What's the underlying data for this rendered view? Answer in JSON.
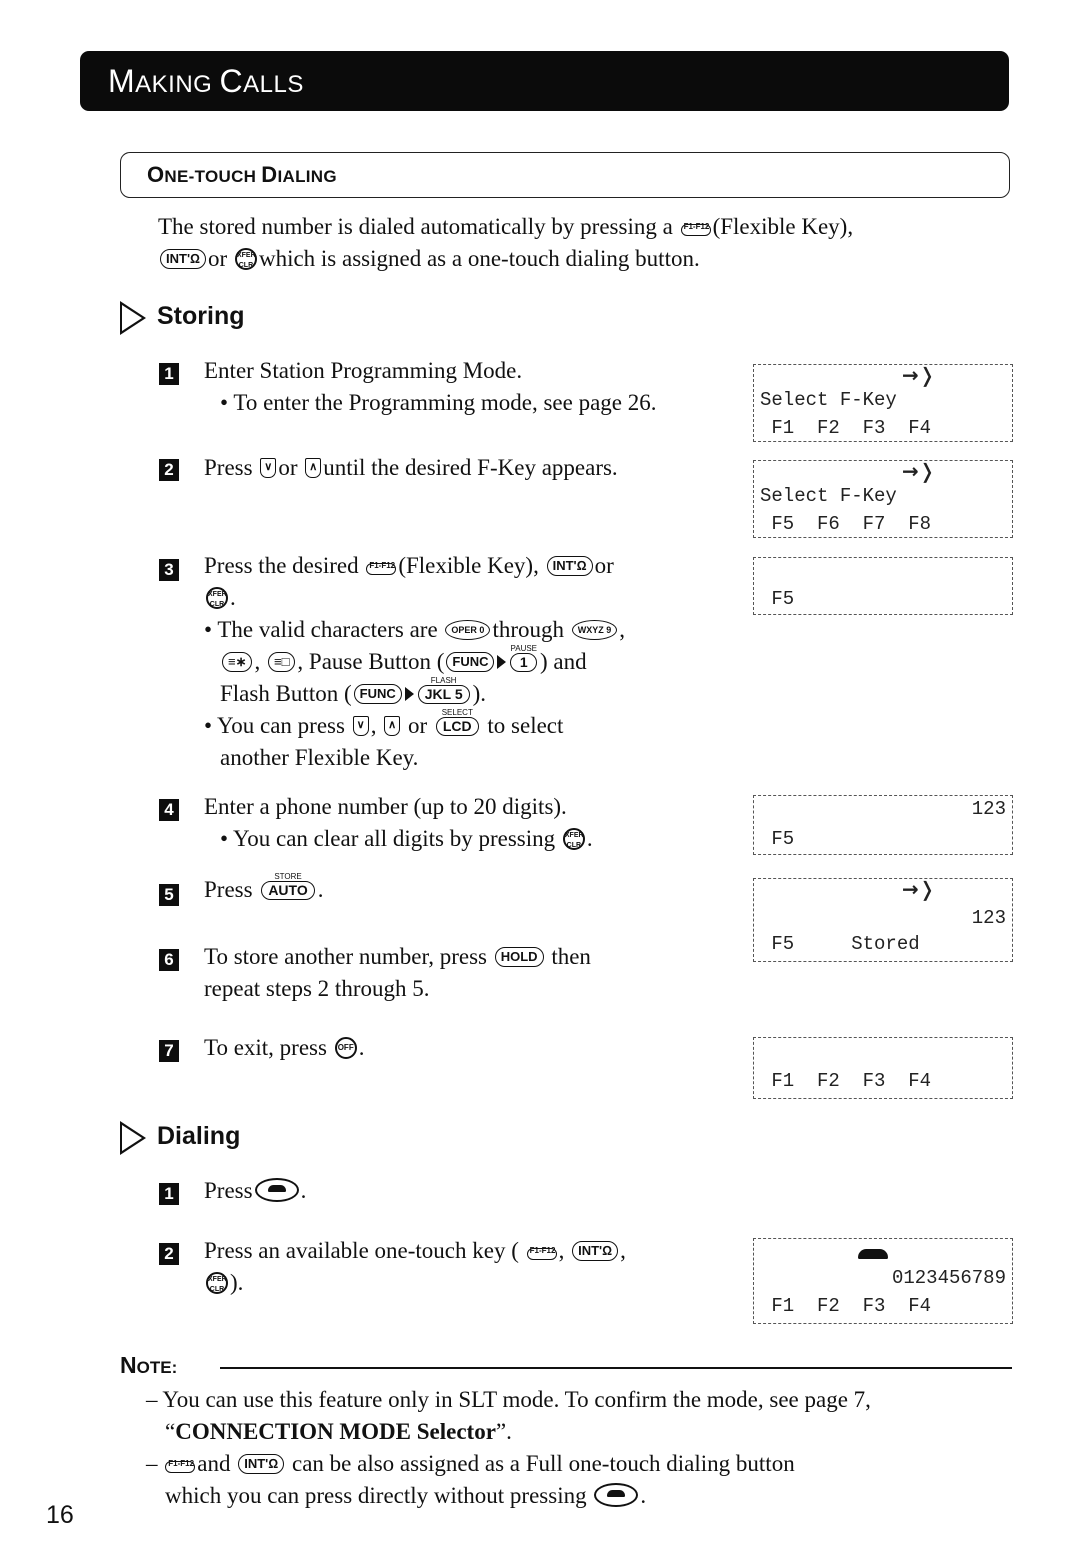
{
  "banner": {
    "title_initial_1": "M",
    "title_rest_1": "AKING",
    "title_initial_2": "C",
    "title_rest_2": "ALLS"
  },
  "section": {
    "title_initial_1": "O",
    "title_rest_1": "NE-TOUCH",
    "title_initial_2": "D",
    "title_rest_2": "IALING"
  },
  "intro": {
    "line1_a": "The stored number is dialed automatically by pressing a",
    "line1_b": "(Flexible Key),",
    "line2_a": "or",
    "line2_b": "which is assigned as a one-touch dialing button."
  },
  "keys": {
    "flex_label": "F1-F12",
    "int_label": "INT'Ω",
    "int_text": "INT'",
    "clr_label": "XFER CLR",
    "func_label": "FUNC",
    "down_arrow": "∨",
    "up_arrow": "∧",
    "select_top": "SELECT",
    "lcd_label": "LCD",
    "store_top": "STORE",
    "auto_label": "AUTO",
    "hold_label": "HOLD",
    "off_label": "OFF",
    "key0": "OPER 0",
    "key9": "WXYZ 9",
    "key_star": "≡∗",
    "key_hash": "≡□",
    "pause_top": "PAUSE",
    "key1": "1",
    "flash_top": "FLASH",
    "key5": "JKL 5"
  },
  "storing": {
    "heading": "Storing",
    "steps": [
      {
        "num": "1",
        "text": "Enter Station Programming Mode.",
        "bullet": "• To enter the Programming mode, see page 26."
      },
      {
        "num": "2",
        "text_a": "Press",
        "text_b": "or",
        "text_c": "until the desired F-Key appears."
      },
      {
        "num": "3",
        "text_a": "Press the desired",
        "text_b": "(Flexible Key),",
        "text_c": "or",
        "bullet1_a": "• The valid characters are",
        "bullet1_b": "through",
        "bullet1_c": ", Pause Button (",
        "bullet1_d": ") and",
        "bullet1_e": "Flash Button (",
        "bullet1_f": ").",
        "bullet2_a": "• You can press",
        "bullet2_b": "or",
        "bullet2_c": "to select",
        "bullet2_d": "another Flexible Key."
      },
      {
        "num": "4",
        "text": "Enter a phone number (up to 20 digits).",
        "bullet": "• You can clear all digits by pressing"
      },
      {
        "num": "5",
        "text": "Press"
      },
      {
        "num": "6",
        "text_a": "To store another number, press",
        "text_b": "then",
        "text_c": "repeat steps 2 through 5."
      },
      {
        "num": "7",
        "text": "To exit, press"
      }
    ]
  },
  "lcd_displays": [
    {
      "arrow": "→❭",
      "line1": "Select F-Key",
      "line2": " F1  F2  F3  F4"
    },
    {
      "arrow": "→❭",
      "line1": "Select F-Key",
      "line2": " F5  F6  F7  F8"
    },
    {
      "line2": " F5"
    },
    {
      "line1": "123",
      "line2": " F5"
    },
    {
      "arrow": "→❭",
      "line1": "123",
      "line2": " F5     Stored"
    },
    {
      "line2": " F1  F2  F3  F4"
    },
    {
      "line1": "0123456789",
      "line2": " F1  F2  F3  F4"
    }
  ],
  "dialing": {
    "heading": "Dialing",
    "steps": [
      {
        "num": "1",
        "text": "Press"
      },
      {
        "num": "2",
        "text_a": "Press an available one-touch key (",
        "text_b": ")."
      }
    ]
  },
  "note": {
    "heading_initial": "N",
    "heading_rest": "OTE:",
    "line1": "– You can use this feature only in SLT mode. To confirm the mode, see page 7,",
    "line2_quote_open": "“",
    "line2_bold": "CONNECTION MODE Selector",
    "line2_quote_close": "”.",
    "line3_a": "–",
    "line3_b": "and",
    "line3_c": "can be also assigned as a Full one-touch dialing button",
    "line4": "which you can press directly without pressing"
  },
  "page_number": "16"
}
